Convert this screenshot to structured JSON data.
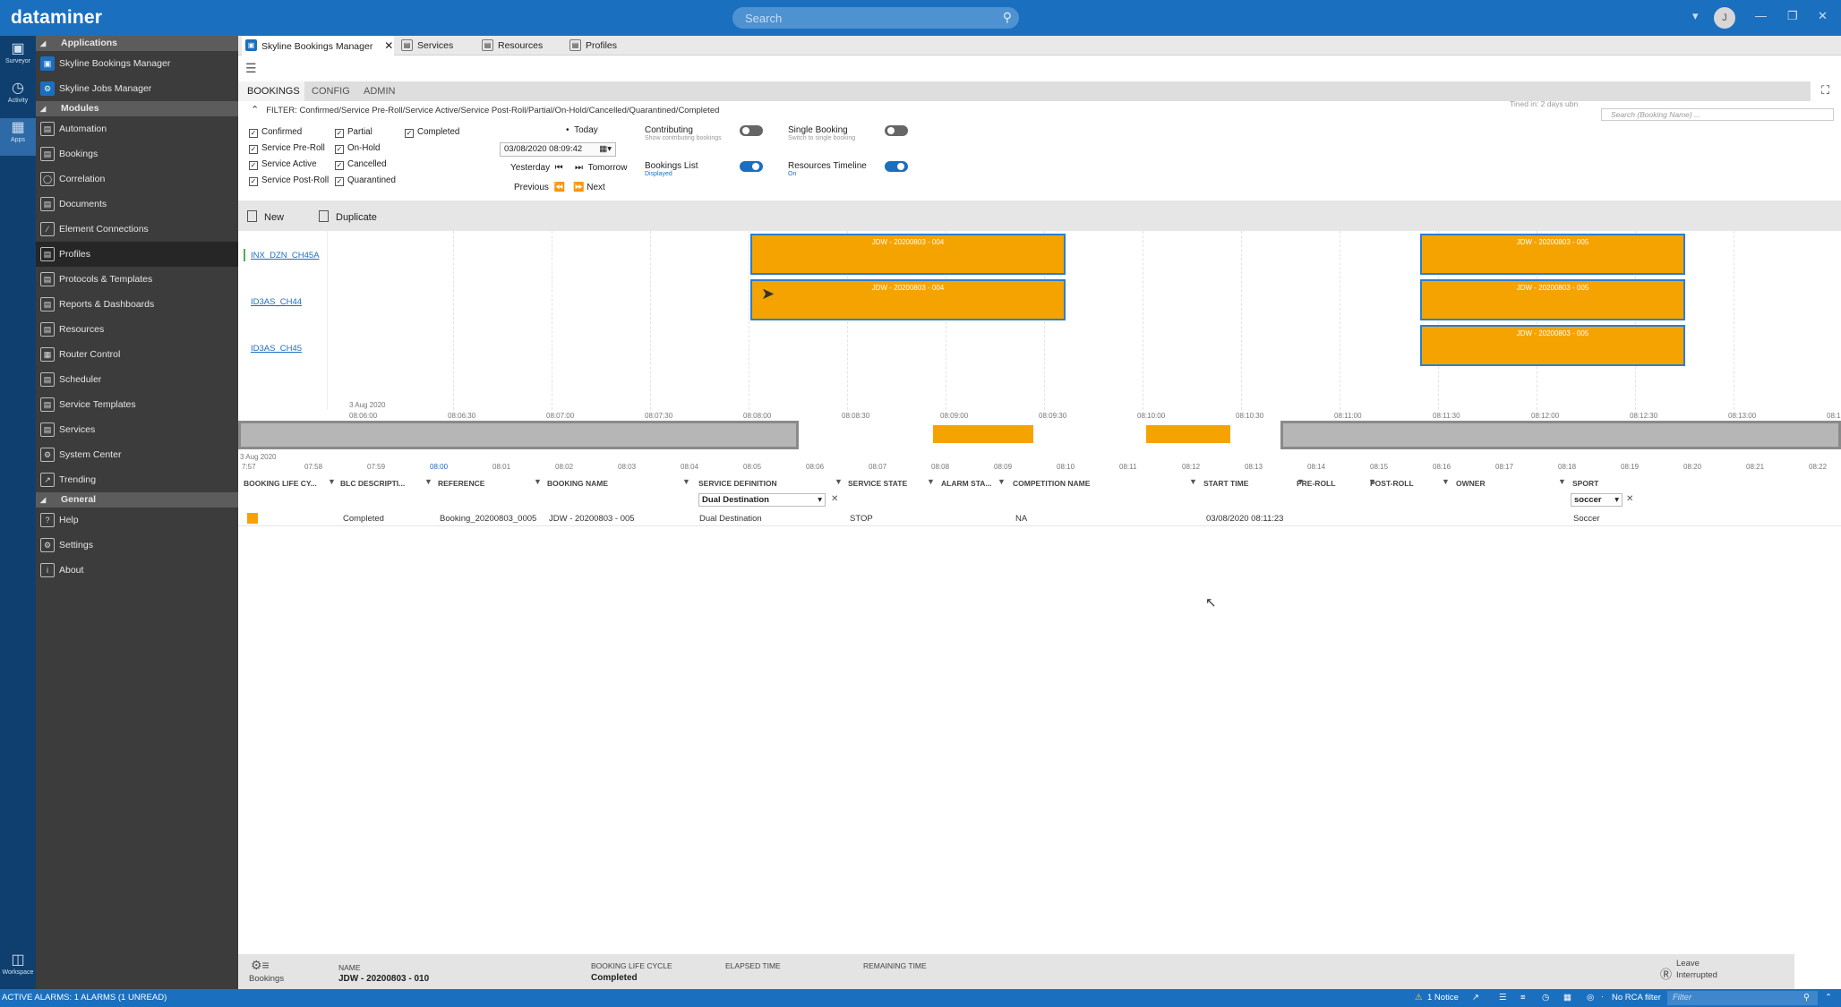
{
  "app": {
    "logo": "dataminer",
    "search_placeholder": "Search",
    "user_initial": "J"
  },
  "rail": [
    {
      "label": "Surveyor",
      "icon": "surveyor-icon"
    },
    {
      "label": "Activity",
      "icon": "activity-icon"
    },
    {
      "label": "Apps",
      "icon": "apps-icon"
    },
    {
      "label": "Workspace",
      "icon": "workspace-icon"
    }
  ],
  "nav": {
    "applications_header": "Applications",
    "applications": [
      "Skyline Bookings Manager",
      "Skyline Jobs Manager"
    ],
    "modules_header": "Modules",
    "modules": [
      "Automation",
      "Bookings",
      "Correlation",
      "Documents",
      "Element Connections",
      "Profiles",
      "Protocols & Templates",
      "Reports & Dashboards",
      "Resources",
      "Router Control",
      "Scheduler",
      "Service Templates",
      "Services",
      "System Center",
      "Trending"
    ],
    "general_header": "General",
    "general": [
      "Help",
      "Settings",
      "About"
    ]
  },
  "tabs": [
    "Skyline Bookings Manager",
    "Services",
    "Resources",
    "Profiles"
  ],
  "subtabs": [
    "BOOKINGS",
    "CONFIG",
    "ADMIN"
  ],
  "filter": {
    "text": "FILTER: Confirmed/Service Pre-Roll/Service Active/Service Post-Roll/Partial/On-Hold/Cancelled/Quarantined/Completed",
    "checkboxes": [
      "Confirmed",
      "Service Pre-Roll",
      "Service Active",
      "Service Post-Roll",
      "Partial",
      "On-Hold",
      "Cancelled",
      "Quarantined",
      "Completed"
    ],
    "today": "Today",
    "date": "03/08/2020 08:09:42",
    "yesterday": "Yesterday",
    "tomorrow": "Tomorrow",
    "previous": "Previous",
    "next": "Next",
    "contributing": "Contributing",
    "contributing_sub": "Show contributing bookings",
    "single_booking": "Single Booking",
    "single_booking_sub": "Switch to single booking",
    "bookings_list": "Bookings List",
    "bookings_list_sub": "Displayed",
    "resources_timeline": "Resources Timeline",
    "resources_timeline_sub": "On",
    "refined": "Tined in: 2 days ubn",
    "name_search_placeholder": "Search (Booking Name) ..."
  },
  "toolbar": {
    "new": "New",
    "duplicate": "Duplicate"
  },
  "timeline": {
    "resources": [
      "INX_DZN_CH45A",
      "ID3AS_CH44",
      "ID3AS_CH45"
    ],
    "blocks": [
      {
        "row": 0,
        "label": "JDW - 20200803 - 004"
      },
      {
        "row": 1,
        "label": "JDW - 20200803 - 004"
      },
      {
        "row": 0,
        "label": "JDW - 20200803 - 005"
      },
      {
        "row": 1,
        "label": "JDW - 20200803 - 005"
      },
      {
        "row": 2,
        "label": "JDW - 20200803 - 005"
      }
    ],
    "date_label": "3 Aug 2020",
    "ticks": [
      "08:06:00",
      "08:06:30",
      "08:07:00",
      "08:07:30",
      "08:08:00",
      "08:08:30",
      "08:09:00",
      "08:09:30",
      "08:10:00",
      "08:10:30",
      "08:11:00",
      "08:11:30",
      "08:12:00",
      "08:12:30",
      "08:13:00",
      "08:1"
    ],
    "overview_date": "3 Aug 2020",
    "overview_ticks": [
      "7:57",
      "07:58",
      "07:59",
      "08:00",
      "08:01",
      "08:02",
      "08:03",
      "08:04",
      "08:05",
      "08:06",
      "08:07",
      "08:08",
      "08:09",
      "08:10",
      "08:11",
      "08:12",
      "08:13",
      "08:14",
      "08:15",
      "08:16",
      "08:17",
      "08:18",
      "08:19",
      "08:20",
      "08:21",
      "08:22"
    ]
  },
  "table": {
    "columns": [
      "BOOKING LIFE CY...",
      "BLC DESCRIPTI...",
      "REFERENCE",
      "BOOKING NAME",
      "SERVICE DEFINITION",
      "SERVICE STATE",
      "ALARM STA...",
      "COMPETITION NAME",
      "START TIME",
      "PRE-ROLL",
      "POST-ROLL",
      "OWNER",
      "SPORT"
    ],
    "service_definition_filter": "Dual Destination",
    "sport_filter": "soccer",
    "rows": [
      {
        "status_color": "#f5a300",
        "blc_description": "Completed",
        "reference": "Booking_20200803_0005",
        "booking_name": "JDW - 20200803 - 005",
        "service_definition": "Dual Destination",
        "service_state": "STOP",
        "competition_name": "NA",
        "start_time": "03/08/2020 08:11:23",
        "sport": "Soccer"
      }
    ]
  },
  "bottom": {
    "icon_label": "Bookings",
    "name_label": "NAME",
    "name_value": "JDW - 20200803 - 010",
    "blc_label": "BOOKING LIFE CYCLE",
    "blc_value": "Completed",
    "elapsed_label": "ELAPSED TIME",
    "remaining_label": "REMAINING TIME",
    "leave": "Leave",
    "interrupted": "Interrupted"
  },
  "statusbar": {
    "alarms": "ACTIVE ALARMS: 1 ALARMS (1 UNREAD)",
    "notice": "1 Notice",
    "rca": "No RCA filter",
    "filter_placeholder": "Filter"
  },
  "colors": {
    "brand": "#1b6fbf",
    "booking": "#f5a300"
  }
}
